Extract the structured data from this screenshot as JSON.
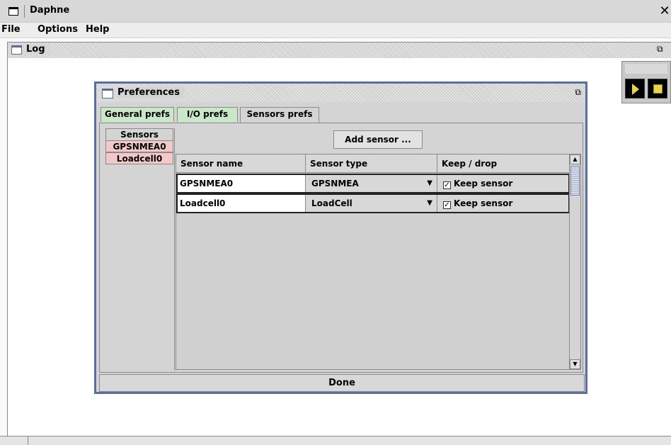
{
  "window": {
    "title": "Daphne",
    "close_glyph": "✕",
    "icon": "window-icon"
  },
  "menu": [
    {
      "label": "File"
    },
    {
      "label": "Options"
    },
    {
      "label": "Help"
    }
  ],
  "log_frame": {
    "title": "Log",
    "icon": "frame-icon",
    "maximize_icon": "restore-icon",
    "maximize_glyph": "⧉"
  },
  "toolbar": {
    "play_icon": "play-icon",
    "stop_icon": "stop-icon",
    "accent": "#e8d44a"
  },
  "preferences": {
    "title": "Preferences",
    "maximize_glyph": "⧉",
    "tabs": [
      {
        "label": "General prefs",
        "color": "#c8e8c8"
      },
      {
        "label": "I/O prefs",
        "color": "#c8e8c8"
      },
      {
        "label": "Sensors prefs",
        "selected": true
      }
    ],
    "side_tabs": [
      {
        "label": "Sensors",
        "selected": true
      },
      {
        "label": "GPSNMEA0",
        "color": "#f2c8c8"
      },
      {
        "label": "Loadcell0",
        "color": "#f2c8c8"
      }
    ],
    "add_sensor_label": "Add sensor ...",
    "table": {
      "columns": [
        "Sensor name",
        "Sensor type",
        "Keep / drop"
      ],
      "rows": [
        {
          "name": "GPSNMEA0",
          "type": "GPSNMEA",
          "keep_label": "Keep sensor",
          "keep": true,
          "check_glyph": "✓"
        },
        {
          "name": "Loadcell0",
          "type": "LoadCell",
          "keep_label": "Keep sensor",
          "keep": true,
          "check_glyph": "✓"
        }
      ]
    },
    "done_label": "Done"
  }
}
